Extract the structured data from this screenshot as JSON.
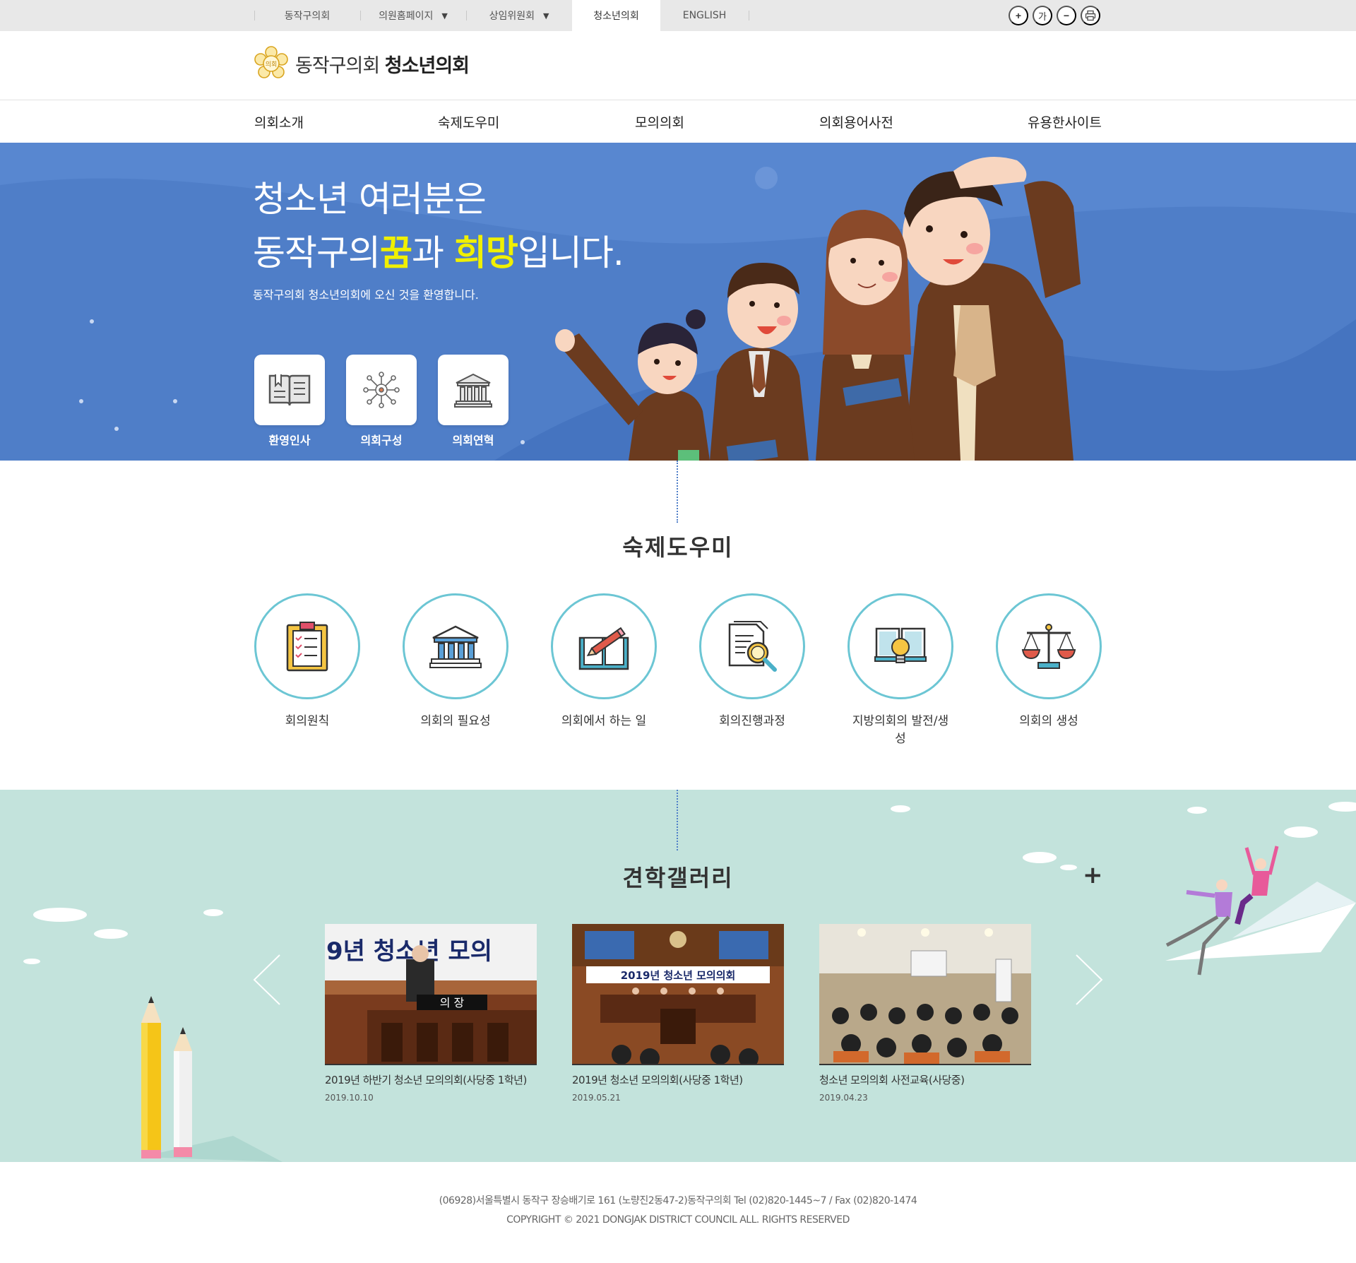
{
  "topbar": {
    "links": [
      {
        "label": "동작구의회",
        "dropdown": false,
        "active": false
      },
      {
        "label": "의원홈페이지",
        "dropdown": true,
        "active": false
      },
      {
        "label": "상임위원회",
        "dropdown": true,
        "active": false
      },
      {
        "label": "청소년의회",
        "dropdown": false,
        "active": true
      },
      {
        "label": "ENGLISH",
        "dropdown": false,
        "active": false
      }
    ],
    "tools": {
      "zoom_in": "+",
      "font_label": "가",
      "zoom_out": "−",
      "print_icon": "printer-icon"
    }
  },
  "logo": {
    "emblem_text": "의회",
    "name_light": "동작구의회",
    "name_bold": "청소년의회"
  },
  "gnb": [
    "의회소개",
    "숙제도우미",
    "모의의회",
    "의회용어사전",
    "유용한사이트"
  ],
  "hero": {
    "line1": "청소년 여러분은",
    "line2_a": "동작구의",
    "line2_hl1": "꿈",
    "line2_b": "과",
    "line2_hl2": "희망",
    "line2_c": "입니다.",
    "subtitle": "동작구의회 청소년의회에 오신 것을 환영합니다.",
    "quick": [
      {
        "label": "환영인사",
        "icon": "book-icon"
      },
      {
        "label": "의회구성",
        "icon": "network-icon"
      },
      {
        "label": "의회연혁",
        "icon": "building-icon"
      }
    ]
  },
  "homework": {
    "title": "숙제도우미",
    "items": [
      {
        "label": "회의원칙",
        "icon": "clipboard-icon"
      },
      {
        "label": "의회의 필요성",
        "icon": "assembly-building-icon"
      },
      {
        "label": "의회에서 하는 일",
        "icon": "open-book-pencil-icon"
      },
      {
        "label": "회의진행과정",
        "icon": "document-search-icon"
      },
      {
        "label": "지방의회의 발전/생성",
        "icon": "book-lightbulb-icon"
      },
      {
        "label": "의회의 생성",
        "icon": "scales-icon"
      }
    ]
  },
  "gallery": {
    "title": "견학갤러리",
    "more": "+",
    "items": [
      {
        "title": "2019년 하반기 청소년 모의의회(사당중 1학년)",
        "date": "2019.10.10",
        "photo_banner": "9년 청소년 모의",
        "photo_sign": "의 장"
      },
      {
        "title": "2019년 청소년 모의의회(사당중 1학년)",
        "date": "2019.05.21",
        "photo_banner": "2019년 청소년 모의의회"
      },
      {
        "title": "청소년 모의의회 사전교육(사당중)",
        "date": "2019.04.23"
      }
    ]
  },
  "footer": {
    "address": "(06928)서울특별시 동작구 장승배기로 161 (노량진2동47-2)동작구의회 Tel (02)820-1445~7 / Fax (02)820-1474",
    "copyright": "COPYRIGHT © 2021 DONGJAK DISTRICT COUNCIL ALL. RIGHTS RESERVED"
  },
  "colors": {
    "hero_bg": "#4f7ec8",
    "accent_yellow": "#f0f000",
    "circle_border": "#6cc6d4",
    "gallery_bg": "#c3e3dc"
  }
}
